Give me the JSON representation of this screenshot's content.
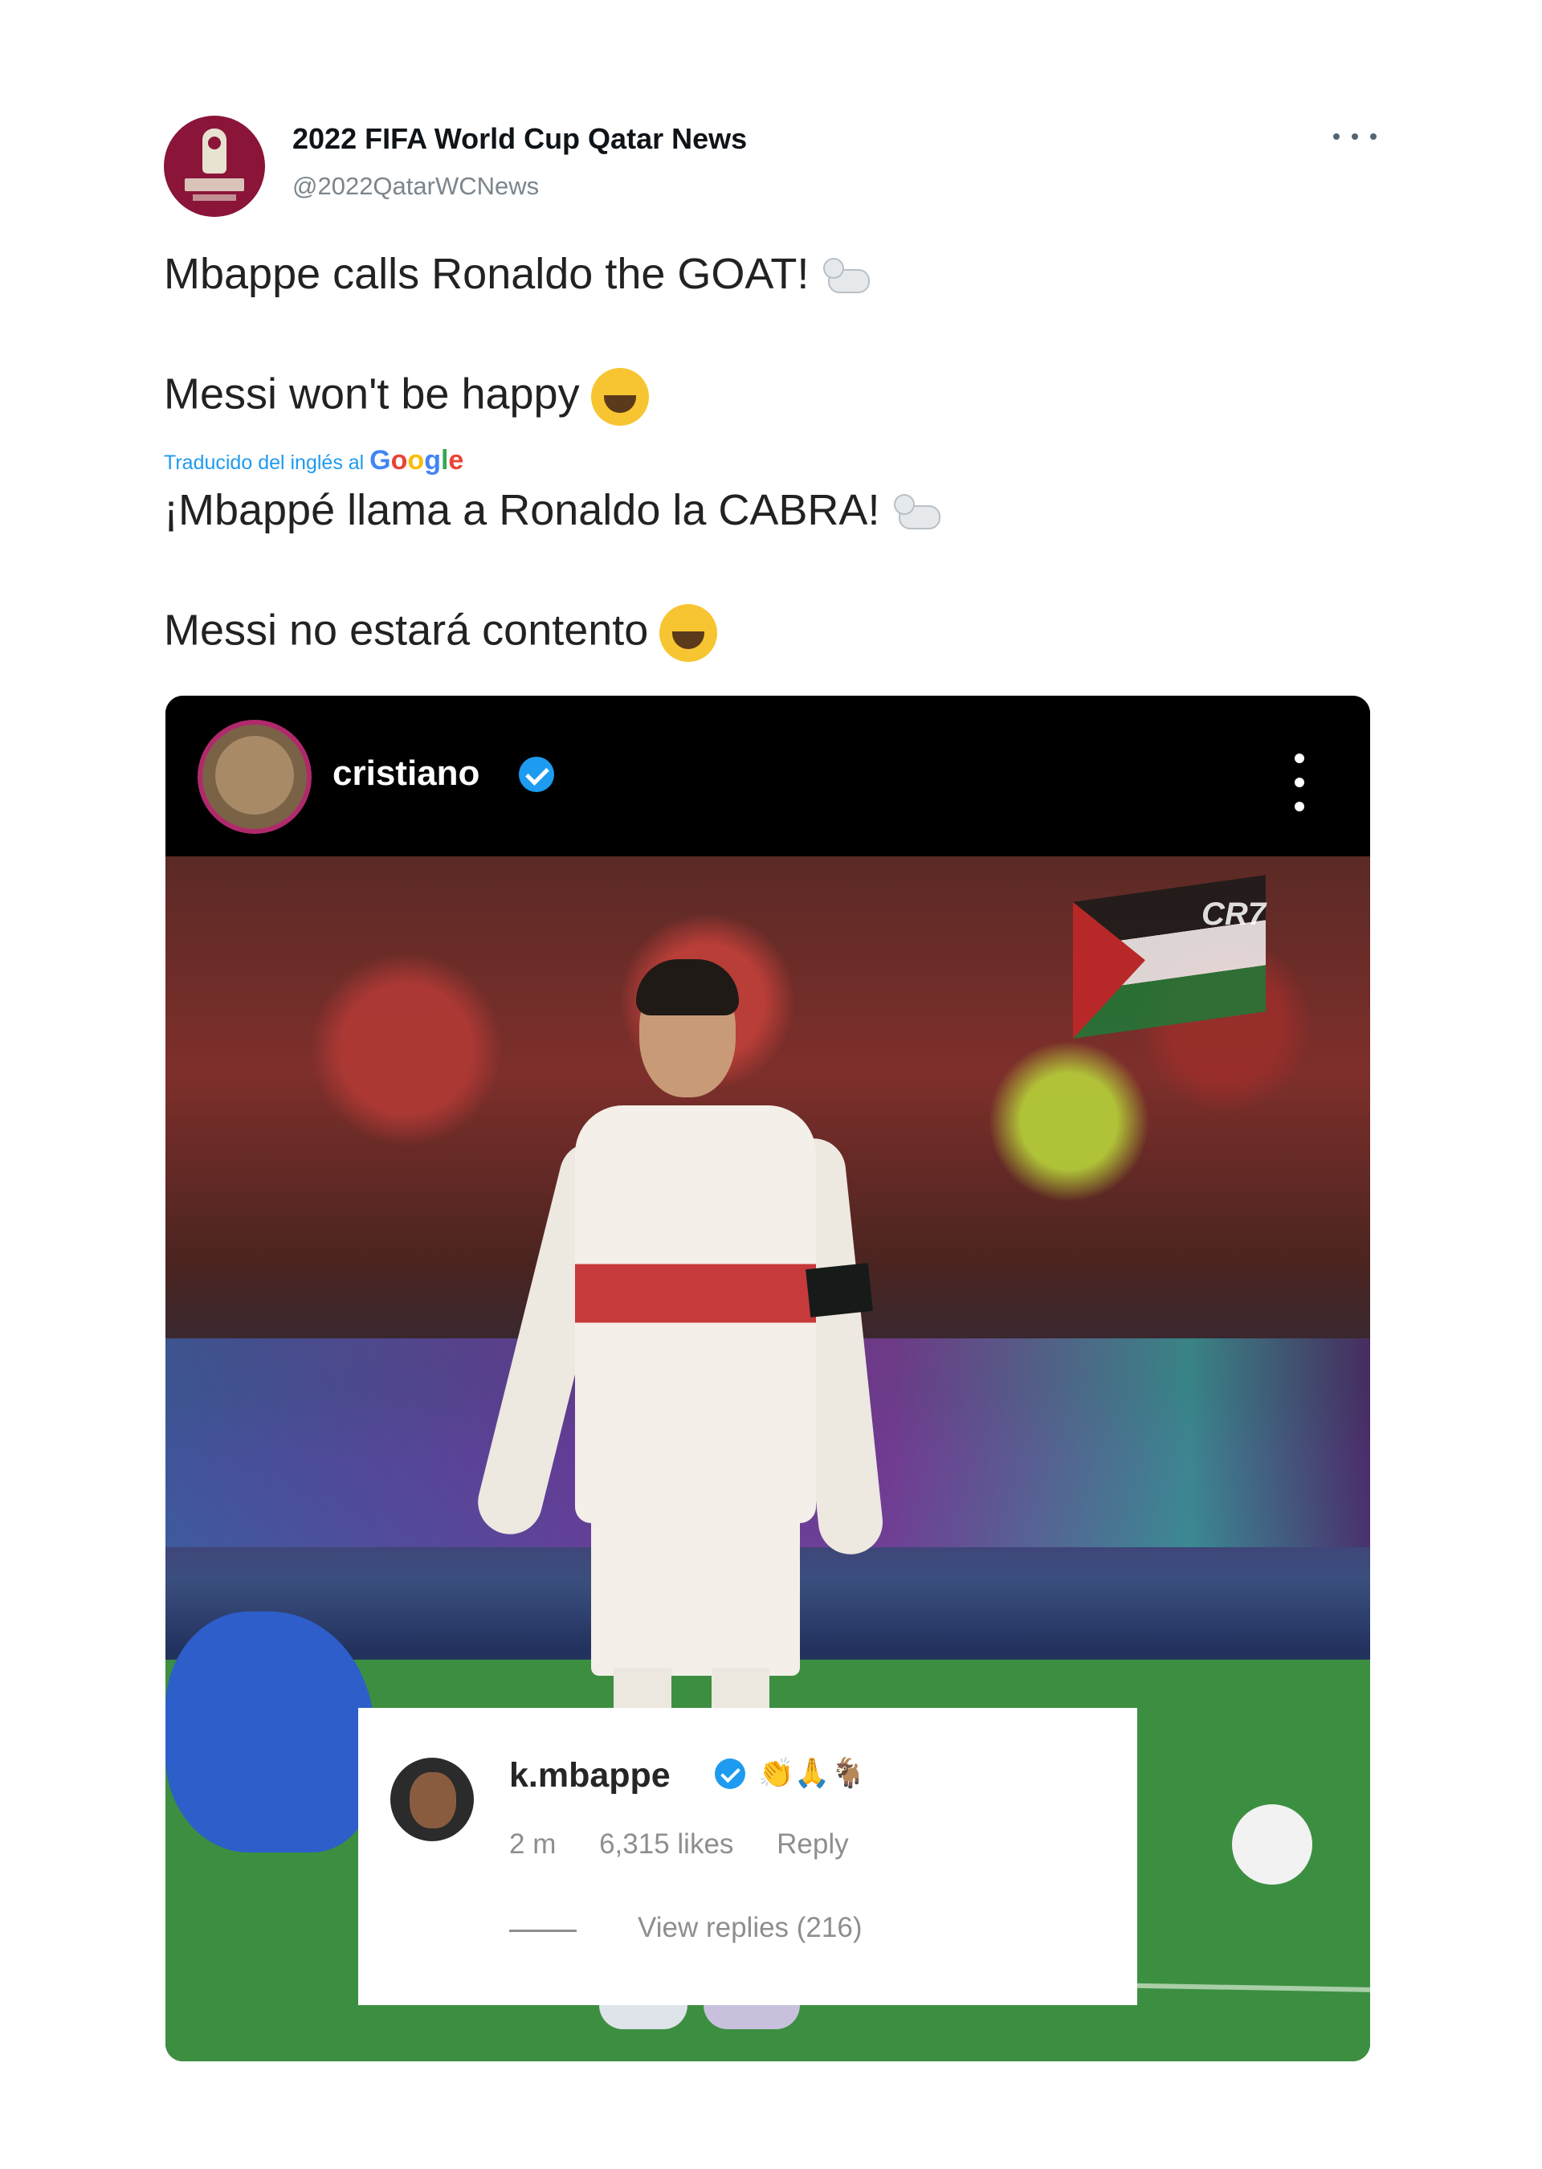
{
  "account": {
    "display_name": "2022 FIFA World Cup Qatar News",
    "handle": "@2022QatarWCNews"
  },
  "tweet": {
    "line1": "Mbappe calls Ronaldo the GOAT!",
    "line2": "Messi won't be happy",
    "translated_note": "Traducido del inglés al",
    "translated_provider": "Google",
    "translation_line1": "¡Mbappé llama a Ronaldo la CABRA!",
    "translation_line2": "Messi no estará contento"
  },
  "media": {
    "ig_username": "cristiano",
    "watermark": "CR7",
    "comment": {
      "username": "k.mbappe",
      "emojis": "👏🙏🐐",
      "time": "2 m",
      "likes": "6,315 likes",
      "reply_label": "Reply",
      "view_replies": "View replies (216)"
    }
  },
  "icons": [
    "more-options-icon",
    "goat-emoji",
    "grinning-emoji",
    "verified-badge-icon",
    "ig-more-icon"
  ],
  "colors": {
    "link_blue": "#1d9bf0",
    "avatar_maroon": "#8a1538",
    "ig_bar": "#000000"
  }
}
